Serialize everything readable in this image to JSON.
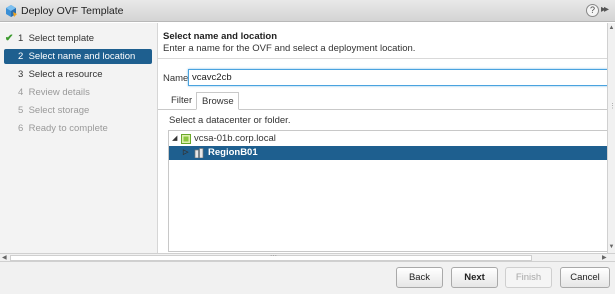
{
  "window": {
    "title": "Deploy OVF Template",
    "help": "?",
    "expand": "▸▸"
  },
  "steps": [
    {
      "num": "1",
      "label": "Select template",
      "state": "done"
    },
    {
      "num": "2",
      "label": "Select name and location",
      "state": "active"
    },
    {
      "num": "3",
      "label": "Select a resource",
      "state": "pending"
    },
    {
      "num": "4",
      "label": "Review details",
      "state": "disabled"
    },
    {
      "num": "5",
      "label": "Select storage",
      "state": "disabled"
    },
    {
      "num": "6",
      "label": "Ready to complete",
      "state": "disabled"
    }
  ],
  "header": {
    "title": "Select name and location",
    "subtitle": "Enter a name for the OVF and select a deployment location."
  },
  "name_field": {
    "label": "Name",
    "value": "vcavc2cb"
  },
  "tabs": [
    {
      "label": "Filter"
    },
    {
      "label": "Browse"
    }
  ],
  "instruction": "Select a datacenter or folder.",
  "tree": [
    {
      "label": "vcsa-01b.corp.local",
      "toggle": "◢",
      "depth": 0
    },
    {
      "label": "RegionB01",
      "toggle": "▷",
      "depth": 1
    }
  ],
  "footer": {
    "back": "Back",
    "next": "Next",
    "finish": "Finish",
    "cancel": "Cancel"
  },
  "colors": {
    "accent": "#1e5f8f",
    "check": "#3c9a2e",
    "focus": "#4aa3df"
  }
}
